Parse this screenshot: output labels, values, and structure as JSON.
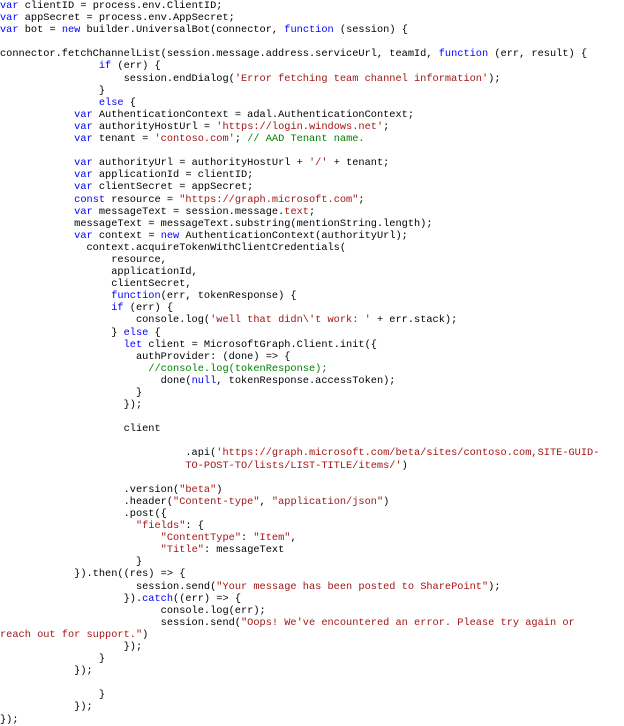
{
  "editor": {
    "lines": [
      [
        [
          "kw",
          "var"
        ],
        [
          "blk",
          " clientID = process.env.ClientID;"
        ]
      ],
      [
        [
          "kw",
          "var"
        ],
        [
          "blk",
          " appSecret = process.env.AppSecret;"
        ]
      ],
      [
        [
          "kw",
          "var"
        ],
        [
          "blk",
          " bot = "
        ],
        [
          "kw",
          "new"
        ],
        [
          "blk",
          " builder.UniversalBot(connector, "
        ],
        [
          "kw",
          "function"
        ],
        [
          "blk",
          " (session) {"
        ]
      ],
      [],
      [
        [
          "blk",
          "connector.fetchChannelList(session.message.address.serviceUrl, teamId, "
        ],
        [
          "kw",
          "function"
        ],
        [
          "blk",
          " (err, result) {"
        ]
      ],
      [
        [
          "blk",
          "                "
        ],
        [
          "kw",
          "if"
        ],
        [
          "blk",
          " (err) {"
        ]
      ],
      [
        [
          "blk",
          "                    session.endDialog("
        ],
        [
          "str",
          "'Error fetching team channel information'"
        ],
        [
          "blk",
          ");"
        ]
      ],
      [
        [
          "blk",
          "                }"
        ]
      ],
      [
        [
          "blk",
          "                "
        ],
        [
          "kw",
          "else"
        ],
        [
          "blk",
          " {"
        ]
      ],
      [
        [
          "blk",
          "            "
        ],
        [
          "kw",
          "var"
        ],
        [
          "blk",
          " AuthenticationContext = adal.AuthenticationContext;"
        ]
      ],
      [
        [
          "blk",
          "            "
        ],
        [
          "kw",
          "var"
        ],
        [
          "blk",
          " authorityHostUrl = "
        ],
        [
          "str",
          "'https://login.windows.net'"
        ],
        [
          "blk",
          ";"
        ]
      ],
      [
        [
          "blk",
          "            "
        ],
        [
          "kw",
          "var"
        ],
        [
          "blk",
          " tenant = "
        ],
        [
          "str",
          "'contoso.com'"
        ],
        [
          "blk",
          "; "
        ],
        [
          "cmt",
          "// AAD Tenant name."
        ]
      ],
      [],
      [
        [
          "blk",
          "            "
        ],
        [
          "kw",
          "var"
        ],
        [
          "blk",
          " authorityUrl = authorityHostUrl + "
        ],
        [
          "str",
          "'/'"
        ],
        [
          "blk",
          " + tenant;"
        ]
      ],
      [
        [
          "blk",
          "            "
        ],
        [
          "kw",
          "var"
        ],
        [
          "blk",
          " applicationId = clientID;"
        ]
      ],
      [
        [
          "blk",
          "            "
        ],
        [
          "kw",
          "var"
        ],
        [
          "blk",
          " clientSecret = appSecret;"
        ]
      ],
      [
        [
          "blk",
          "            "
        ],
        [
          "kw",
          "const"
        ],
        [
          "blk",
          " resource = "
        ],
        [
          "str",
          "\"https://graph.microsoft.com\""
        ],
        [
          "blk",
          ";"
        ]
      ],
      [
        [
          "blk",
          "            "
        ],
        [
          "kw",
          "var"
        ],
        [
          "blk",
          " messageText = session.message."
        ],
        [
          "str",
          "text"
        ],
        [
          "blk",
          ";"
        ]
      ],
      [
        [
          "blk",
          "            messageText = messageText.substring(mentionString.length);"
        ]
      ],
      [
        [
          "blk",
          "            "
        ],
        [
          "kw",
          "var"
        ],
        [
          "blk",
          " context = "
        ],
        [
          "kw",
          "new"
        ],
        [
          "blk",
          " AuthenticationContext(authorityUrl);"
        ]
      ],
      [
        [
          "blk",
          "              context.acquireTokenWithClientCredentials("
        ]
      ],
      [
        [
          "blk",
          "                  resource,"
        ]
      ],
      [
        [
          "blk",
          "                  applicationId,"
        ]
      ],
      [
        [
          "blk",
          "                  clientSecret,"
        ]
      ],
      [
        [
          "blk",
          "                  "
        ],
        [
          "kw",
          "function"
        ],
        [
          "blk",
          "(err, tokenResponse) {"
        ]
      ],
      [
        [
          "blk",
          "                  "
        ],
        [
          "kw",
          "if"
        ],
        [
          "blk",
          " (err) {"
        ]
      ],
      [
        [
          "blk",
          "                      console.log("
        ],
        [
          "str",
          "'well that didn\\'t work: '"
        ],
        [
          "blk",
          " + err.stack);"
        ]
      ],
      [
        [
          "blk",
          "                  } "
        ],
        [
          "kw",
          "else"
        ],
        [
          "blk",
          " {"
        ]
      ],
      [
        [
          "blk",
          "                    "
        ],
        [
          "kw",
          "let"
        ],
        [
          "blk",
          " client = MicrosoftGraph.Client.init({"
        ]
      ],
      [
        [
          "blk",
          "                      authProvider: (done) => {"
        ]
      ],
      [
        [
          "blk",
          "                        "
        ],
        [
          "cmt",
          "//console.log(tokenResponse);"
        ]
      ],
      [
        [
          "blk",
          "                          done("
        ],
        [
          "kw",
          "null"
        ],
        [
          "blk",
          ", tokenResponse.accessToken);"
        ]
      ],
      [
        [
          "blk",
          "                      }"
        ]
      ],
      [
        [
          "blk",
          "                    });"
        ]
      ],
      [],
      [
        [
          "blk",
          "                    client"
        ]
      ],
      [],
      [
        [
          "blk",
          "                              .api("
        ],
        [
          "str",
          "'https://graph.microsoft.com/beta/sites/contoso.com,SITE-GUID-"
        ]
      ],
      [
        [
          "str",
          "                              TO-POST-TO/lists/LIST-TITLE/items/'"
        ],
        [
          "blk",
          ")"
        ]
      ],
      [],
      [
        [
          "blk",
          "                    .version("
        ],
        [
          "str",
          "\"beta\""
        ],
        [
          "blk",
          ")"
        ]
      ],
      [
        [
          "blk",
          "                    .header("
        ],
        [
          "str",
          "\"Content-type\""
        ],
        [
          "blk",
          ", "
        ],
        [
          "str",
          "\"application/json\""
        ],
        [
          "blk",
          ")"
        ]
      ],
      [
        [
          "blk",
          "                    .post({"
        ]
      ],
      [
        [
          "blk",
          "                      "
        ],
        [
          "str",
          "\"fields\""
        ],
        [
          "blk",
          ": {"
        ]
      ],
      [
        [
          "blk",
          "                          "
        ],
        [
          "str",
          "\"ContentType\""
        ],
        [
          "blk",
          ": "
        ],
        [
          "str",
          "\"Item\""
        ],
        [
          "blk",
          ","
        ]
      ],
      [
        [
          "blk",
          "                          "
        ],
        [
          "str",
          "\"Title\""
        ],
        [
          "blk",
          ": messageText"
        ]
      ],
      [
        [
          "blk",
          "                      }"
        ]
      ],
      [
        [
          "blk",
          "            }).then((res) => {"
        ]
      ],
      [
        [
          "blk",
          "                      session.send("
        ],
        [
          "str",
          "\"Your message has been posted to SharePoint\""
        ],
        [
          "blk",
          ");"
        ]
      ],
      [
        [
          "blk",
          "                    })."
        ],
        [
          "kw",
          "catch"
        ],
        [
          "blk",
          "((err) => {"
        ]
      ],
      [
        [
          "blk",
          "                          console.log(err);"
        ]
      ],
      [
        [
          "blk",
          "                          session.send("
        ],
        [
          "str",
          "\"Oops! We've encountered an error. Please try again or"
        ]
      ],
      [
        [
          "str",
          "reach out for support.\""
        ],
        [
          "blk",
          ")"
        ]
      ],
      [
        [
          "blk",
          "                    });"
        ]
      ],
      [
        [
          "blk",
          "                }"
        ]
      ],
      [
        [
          "blk",
          "            });"
        ]
      ],
      [],
      [
        [
          "blk",
          "                }"
        ]
      ],
      [
        [
          "blk",
          "            });"
        ]
      ],
      [
        [
          "blk",
          "});"
        ]
      ]
    ]
  }
}
